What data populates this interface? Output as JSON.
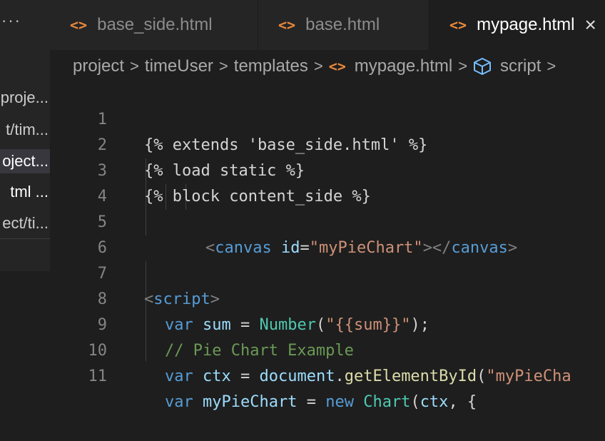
{
  "sidebar": {
    "more_label": "···",
    "files": [
      {
        "label": "proje..."
      },
      {
        "label": "t/tim..."
      },
      {
        "label": "oject..."
      },
      {
        "label": "tml  ..."
      },
      {
        "label": "ect/ti..."
      }
    ]
  },
  "tabs": [
    {
      "label": "base_side.html",
      "icon": "html-icon"
    },
    {
      "label": "base.html",
      "icon": "html-icon"
    },
    {
      "label": "mypage.html",
      "icon": "html-icon",
      "active": true
    }
  ],
  "tab_close_label": "×",
  "breadcrumb": {
    "items": [
      "project",
      "timeUser",
      "templates",
      "mypage.html",
      "script"
    ]
  },
  "editor": {
    "line_numbers": [
      "1",
      "2",
      "3",
      "4",
      "5",
      "6",
      "7",
      "8",
      "9",
      "10",
      "11"
    ],
    "lines": {
      "l1": "{% extends 'base_side.html' %}",
      "l2": "{% load static %}",
      "l3": "{% block content_side %}",
      "l5_open": "<",
      "l5_tag": "canvas",
      "l5_attr": "id",
      "l5_eq": "=",
      "l5_val": "\"myPieChart\"",
      "l5_close": "></",
      "l5_endtag": "canvas",
      "l5_gt": ">",
      "l7_open": "<",
      "l7_tag": "script",
      "l7_gt": ">",
      "l8_kw": "var",
      "l8_var": "sum",
      "l8_eq": " = ",
      "l8_cls": "Number",
      "l8_p1": "(",
      "l8_str": "\"{{sum}}\"",
      "l8_p2": ");",
      "l9_cmt": "// Pie Chart Example",
      "l10_kw": "var",
      "l10_var": "ctx",
      "l10_eq": " = ",
      "l10_obj": "document",
      "l10_dot": ".",
      "l10_fn": "getElementById",
      "l10_p": "(",
      "l10_str": "\"myPieCha",
      "l11_kw": "var",
      "l11_var": "myPieChart",
      "l11_eq": " = ",
      "l11_new": "new",
      "l11_cls": "Chart",
      "l11_p": "(",
      "l11_arg": "ctx",
      "l11_rest": ", {"
    }
  }
}
